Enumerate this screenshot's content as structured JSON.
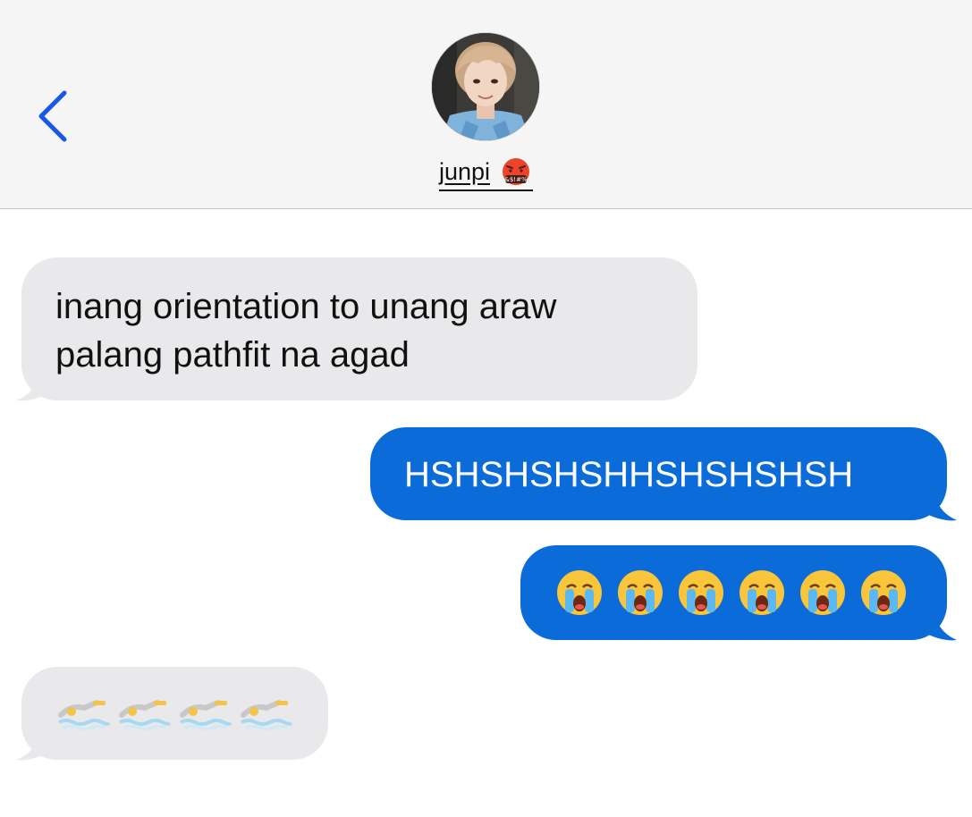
{
  "header": {
    "contact_name": "junpi",
    "back_icon": "chevron-left-icon",
    "name_emoji": "face-with-symbols-on-mouth",
    "colors": {
      "header_bg": "#f5f5f5",
      "accent": "#1a56e8"
    }
  },
  "messages": [
    {
      "direction": "received",
      "lines": [
        "inang orientation to unang araw",
        "palang pathfit na agad"
      ]
    },
    {
      "direction": "sent",
      "text": "HSHSHSHSHHSHSHSHSH"
    },
    {
      "direction": "sent",
      "emoji": "loudly-crying-face",
      "count": 6
    },
    {
      "direction": "received",
      "emoji": "person-swimming",
      "count": 4
    }
  ],
  "colors": {
    "received_bubble": "#e9e9eb",
    "sent_bubble": "#0b6bd8"
  }
}
